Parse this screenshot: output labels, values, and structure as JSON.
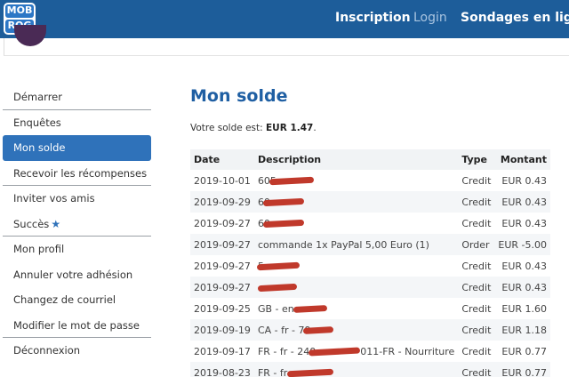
{
  "header": {
    "logo_line1": "MOB",
    "logo_line2": "ROG",
    "nav": [
      "Inscription",
      "Login",
      "Sondages en ligne"
    ]
  },
  "sidebar": {
    "items": [
      {
        "label": "Démarrer",
        "sep": true
      },
      {
        "label": "Enquêtes",
        "sep": false
      },
      {
        "label": "Mon solde",
        "active": true
      },
      {
        "label": "Recevoir les récompenses",
        "sep": true
      },
      {
        "label": "Inviter vos amis",
        "sep": false
      },
      {
        "label": "Succès",
        "star": "★",
        "sep": true
      },
      {
        "label": "Mon profil",
        "sep": false
      },
      {
        "label": "Annuler votre adhésion",
        "sep": false
      },
      {
        "label": "Changez de courriel",
        "sep": false
      },
      {
        "label": "Modifier le mot de passe",
        "sep": true
      },
      {
        "label": "Déconnexion",
        "sep": false
      }
    ]
  },
  "main": {
    "title": "Mon solde",
    "balance_prefix": "Votre solde est:",
    "balance_value": "EUR 1.47",
    "balance_suffix": "."
  },
  "table": {
    "headers": [
      "Date",
      "Description",
      "Type",
      "Montant"
    ],
    "rows": [
      {
        "date": "2019-10-01",
        "desc": "605",
        "type": "Credit",
        "amount": "EUR 0.43",
        "redact": 50
      },
      {
        "date": "2019-09-29",
        "desc": "60",
        "type": "Credit",
        "amount": "EUR 0.43",
        "redact": 46
      },
      {
        "date": "2019-09-27",
        "desc": "60",
        "type": "Credit",
        "amount": "EUR 0.43",
        "redact": 46
      },
      {
        "date": "2019-09-27",
        "desc": "commande 1x PayPal 5,00 Euro (1)",
        "type": "Order",
        "amount": "EUR -5.00",
        "redact": 0
      },
      {
        "date": "2019-09-27",
        "desc": "5",
        "type": "Credit",
        "amount": "EUR 0.43",
        "redact": 48
      },
      {
        "date": "2019-09-27",
        "desc": "",
        "type": "Credit",
        "amount": "EUR 0.43",
        "redact": 44
      },
      {
        "date": "2019-09-25",
        "desc": "GB - en -",
        "type": "Credit",
        "amount": "EUR 1.60",
        "redact": 38
      },
      {
        "date": "2019-09-19",
        "desc": "CA - fr - 79",
        "type": "Credit",
        "amount": "EUR 1.18",
        "redact": 34
      },
      {
        "date": "2019-09-17",
        "desc": "FR - fr - 240",
        "desc_tail": "011-FR - Nourriture",
        "type": "Credit",
        "amount": "EUR 0.77",
        "redact": 58
      },
      {
        "date": "2019-08-23",
        "desc": "FR - fr -",
        "type": "Credit",
        "amount": "EUR 0.77",
        "redact": 52
      }
    ]
  }
}
